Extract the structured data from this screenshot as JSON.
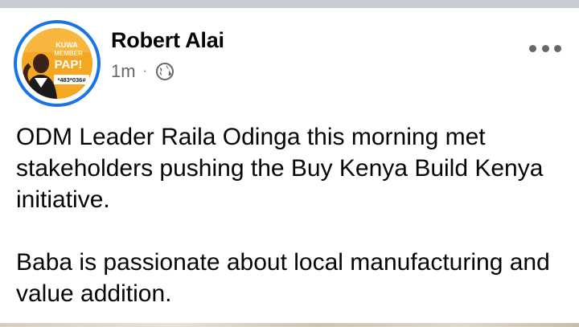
{
  "post": {
    "author": {
      "name": "Robert Alai",
      "avatar_alt": "profile-photo"
    },
    "meta": {
      "time": "1m",
      "separator": "·",
      "privacy_icon": "globe-icon"
    },
    "more_icon": "more-dots-icon",
    "text": "ODM Leader Raila Odinga this morning met stakeholders pushing the Buy Kenya Build Kenya initiative.\n\nBaba is passionate about local manufacturing and value addition."
  },
  "avatar_badge": {
    "line1": "KUWA",
    "line2": "MEMBER",
    "line3": "PAP!",
    "code": "*483*036#"
  },
  "colors": {
    "ring": "#1b74e4",
    "avatar_bg": "#f39c12",
    "divider": "#c9ccd1",
    "meta_text": "#65676b"
  }
}
